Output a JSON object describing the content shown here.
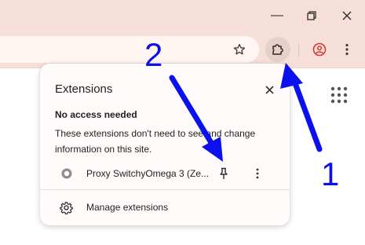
{
  "window_controls": {
    "minimize_icon": "minimize-icon",
    "restore_icon": "restore-icon",
    "close_icon": "close-icon"
  },
  "toolbar": {
    "bookmark_icon": "star-icon",
    "extensions_icon": "puzzle-icon",
    "profile_icon": "profile-icon",
    "menu_icon": "kebab-menu-icon"
  },
  "popup": {
    "title": "Extensions",
    "close_icon": "close-icon",
    "section_heading": "No access needed",
    "section_description": "These extensions don't need to see and change information on this site.",
    "extension_name": "Proxy SwitchyOmega 3 (Ze...",
    "pin_icon": "pin-icon",
    "more_icon": "more-icon",
    "manage_label": "Manage extensions"
  },
  "annotations": {
    "label_1": "1",
    "label_2": "2",
    "color": "#0a11ee"
  },
  "colors": {
    "titlebar": "#f6dfd8",
    "popup_bg": "#fffbfa",
    "accent_profile": "#d23b2f"
  }
}
